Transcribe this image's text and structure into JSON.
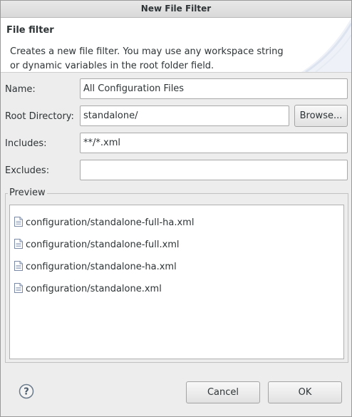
{
  "window": {
    "title": "New File Filter"
  },
  "banner": {
    "title": "File filter",
    "description": "Creates a new file filter. You may use any workspace string or dynamic variables in the root folder field."
  },
  "form": {
    "name": {
      "label": "Name:",
      "value": "All Configuration Files"
    },
    "root_directory": {
      "label": "Root Directory:",
      "value": "standalone/",
      "browse_label": "Browse..."
    },
    "includes": {
      "label": "Includes:",
      "value": "**/*.xml"
    },
    "excludes": {
      "label": "Excludes:",
      "value": ""
    }
  },
  "preview": {
    "label": "Preview",
    "items": [
      {
        "name": "configuration/standalone-full-ha.xml",
        "icon": "xml-file-icon"
      },
      {
        "name": "configuration/standalone-full.xml",
        "icon": "xml-file-icon"
      },
      {
        "name": "configuration/standalone-ha.xml",
        "icon": "xml-file-icon"
      },
      {
        "name": "configuration/standalone.xml",
        "icon": "xml-file-icon"
      }
    ]
  },
  "buttons": {
    "cancel_label": "Cancel",
    "ok_label": "OK",
    "help_icon": "help-icon"
  },
  "colors": {
    "background": "#ededed",
    "banner": "#ffffff",
    "field_border": "#a9a9a9"
  }
}
